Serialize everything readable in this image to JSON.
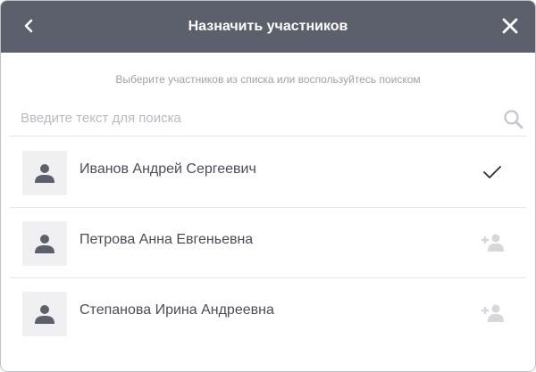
{
  "header": {
    "title": "Назначить участников",
    "back_icon": "chevron-left-icon",
    "close_icon": "close-icon",
    "background": "#5c606c"
  },
  "hint": "Выберите участников из списка или воспользуйтесь поиском",
  "search": {
    "placeholder": "Введите текст для поиска",
    "value": "",
    "icon": "search-icon"
  },
  "participants": [
    {
      "name": "Иванов Андрей Сергеевич",
      "selected": true,
      "action_icon": "checkmark-icon"
    },
    {
      "name": "Петрова Анна Евгеньевна",
      "selected": false,
      "action_icon": "add-user-icon"
    },
    {
      "name": "Степанова Ирина Андреевна",
      "selected": false,
      "action_icon": "add-user-icon"
    }
  ]
}
